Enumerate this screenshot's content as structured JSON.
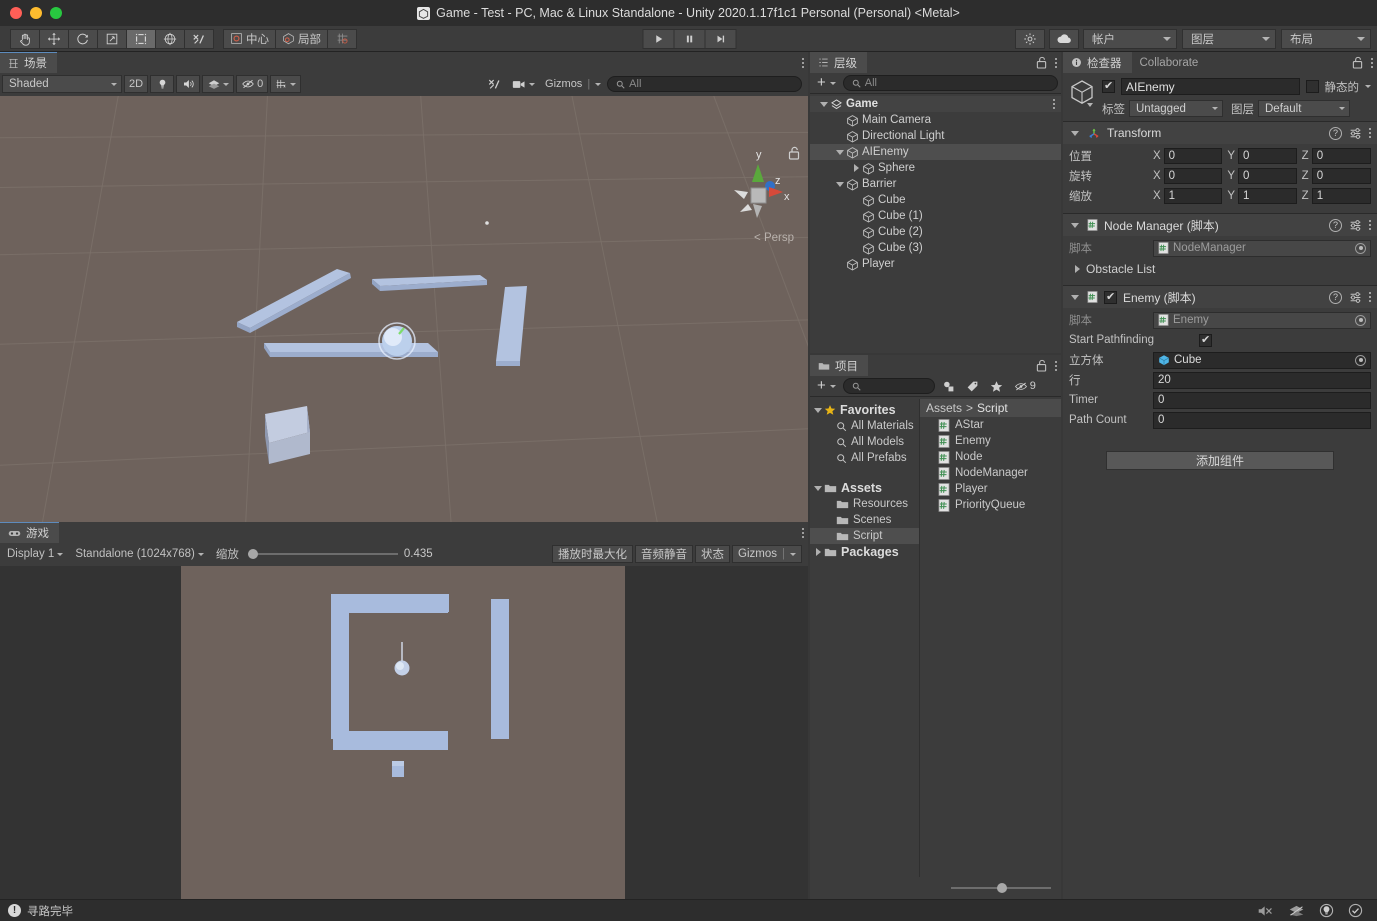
{
  "titlebar": {
    "title": "Game - Test - PC, Mac & Linux Standalone - Unity 2020.1.17f1c1 Personal (Personal) <Metal>",
    "logo_icon": "unity-logo-icon"
  },
  "toolbar": {
    "tools": [
      {
        "name": "hand-tool",
        "icon": "hand-icon"
      },
      {
        "name": "move-tool",
        "icon": "move-arrows-icon"
      },
      {
        "name": "rotate-tool",
        "icon": "rotate-icon"
      },
      {
        "name": "scale-tool",
        "icon": "scale-icon"
      },
      {
        "name": "rect-tool",
        "icon": "rect-transform-icon",
        "active": true
      },
      {
        "name": "transform-tool",
        "icon": "transform-globe-icon"
      },
      {
        "name": "custom-editor-tool",
        "icon": "wrench-hammer-icon"
      }
    ],
    "pivot_label": "中心",
    "pivot_icon": "pivot-center-icon",
    "space_label": "局部",
    "space_icon": "local-space-icon",
    "grid_snap_icon": "grid-snap-icon",
    "play_label": "▶",
    "pause_label": "❚❚",
    "step_label": "▶❘",
    "cloud_icon": "cloud-icon",
    "services_icon": "services-settings-icon",
    "account_label": "帐户",
    "layers_label": "图层",
    "layout_label": "布局"
  },
  "scene": {
    "tab_label": "场景",
    "tab_icon": "scene-grid-icon",
    "draw_mode": "Shaded",
    "toggle_2d": "2D",
    "lighting_icon": "lightbulb-icon",
    "audio_icon": "audio-icon",
    "fx_icon": "effects-icon",
    "hidden_count": "0",
    "hidden_icon": "eye-off-icon",
    "grid_icon": "grid-visibility-icon",
    "tools_icon": "scene-tools-icon",
    "camera_icon": "scene-camera-icon",
    "gizmos_label": "Gizmos",
    "search_placeholder": "All",
    "search_icon": "search-icon",
    "axis_labels": {
      "x": "x",
      "y": "y",
      "z": "z"
    },
    "perspective_label": "Persp",
    "lock_icon": "lock-open-icon"
  },
  "game": {
    "tab_label": "游戏",
    "tab_icon": "gamepad-icon",
    "display_label": "Display 1",
    "resolution_label": "Standalone (1024x768)",
    "scale_label": "缩放",
    "scale_value": "0.435",
    "maximize_label": "播放时最大化",
    "mute_label": "音频静音",
    "stats_label": "状态",
    "gizmos_label": "Gizmos"
  },
  "hierarchy": {
    "tab_label": "层级",
    "tab_icon": "hierarchy-icon",
    "lock_icon": "lock-open-icon",
    "add_label": "+",
    "search_placeholder": "All",
    "search_icon": "search-icon",
    "items": [
      {
        "label": "Game",
        "depth": 0,
        "icon": "scene-icon",
        "arrow": "down",
        "root": true,
        "menu": true
      },
      {
        "label": "Main Camera",
        "depth": 1,
        "icon": "gameobject-icon",
        "arrow": "none"
      },
      {
        "label": "Directional Light",
        "depth": 1,
        "icon": "gameobject-icon",
        "arrow": "none"
      },
      {
        "label": "AIEnemy",
        "depth": 1,
        "icon": "gameobject-icon",
        "arrow": "down",
        "selected": true
      },
      {
        "label": "Sphere",
        "depth": 2,
        "icon": "gameobject-icon",
        "arrow": "right"
      },
      {
        "label": "Barrier",
        "depth": 1,
        "icon": "gameobject-icon",
        "arrow": "down"
      },
      {
        "label": "Cube",
        "depth": 2,
        "icon": "gameobject-icon",
        "arrow": "none"
      },
      {
        "label": "Cube (1)",
        "depth": 2,
        "icon": "gameobject-icon",
        "arrow": "none"
      },
      {
        "label": "Cube (2)",
        "depth": 2,
        "icon": "gameobject-icon",
        "arrow": "none"
      },
      {
        "label": "Cube (3)",
        "depth": 2,
        "icon": "gameobject-icon",
        "arrow": "none"
      },
      {
        "label": "Player",
        "depth": 1,
        "icon": "gameobject-icon",
        "arrow": "none"
      }
    ]
  },
  "project": {
    "tab_label": "项目",
    "tab_icon": "folder-icon",
    "lock_icon": "lock-open-icon",
    "add_label": "+",
    "search_placeholder": "",
    "search_icon": "search-icon",
    "filter_type_icon": "filter-by-type-icon",
    "filter_label_icon": "filter-by-label-icon",
    "favorites_filter_icon": "star-icon",
    "hidden_packages_icon": "eye-off-icon",
    "hidden_packages_count": "9",
    "tree": [
      {
        "label": "Favorites",
        "depth": 0,
        "arrow": "down",
        "icon": "star-icon"
      },
      {
        "label": "All Materials",
        "depth": 1,
        "arrow": "none",
        "icon": "search-icon"
      },
      {
        "label": "All Models",
        "depth": 1,
        "arrow": "none",
        "icon": "search-icon"
      },
      {
        "label": "All Prefabs",
        "depth": 1,
        "arrow": "none",
        "icon": "search-icon"
      },
      {
        "label": "",
        "depth": 0,
        "arrow": "none",
        "icon": "spacer"
      },
      {
        "label": "Assets",
        "depth": 0,
        "arrow": "down",
        "icon": "folder-open-icon"
      },
      {
        "label": "Resources",
        "depth": 1,
        "arrow": "none",
        "icon": "folder-icon"
      },
      {
        "label": "Scenes",
        "depth": 1,
        "arrow": "none",
        "icon": "folder-icon"
      },
      {
        "label": "Script",
        "depth": 1,
        "arrow": "none",
        "icon": "folder-icon",
        "selected": true
      },
      {
        "label": "Packages",
        "depth": 0,
        "arrow": "right",
        "icon": "folder-icon"
      }
    ],
    "breadcrumb": [
      "Assets",
      "Script"
    ],
    "files": [
      {
        "label": "AStar",
        "icon": "csharp-script-icon"
      },
      {
        "label": "Enemy",
        "icon": "csharp-script-icon"
      },
      {
        "label": "Node",
        "icon": "csharp-script-icon"
      },
      {
        "label": "NodeManager",
        "icon": "csharp-script-icon"
      },
      {
        "label": "Player",
        "icon": "csharp-script-icon"
      },
      {
        "label": "PriorityQueue",
        "icon": "csharp-script-icon"
      }
    ]
  },
  "inspector": {
    "tab_label": "检查器",
    "tab_icon": "info-icon",
    "collab_tab_label": "Collaborate",
    "lock_icon": "lock-open-icon",
    "object": {
      "icon": "gameobject-icon",
      "enabled": true,
      "name": "AIEnemy",
      "static_label": "静态的",
      "static_checked": false,
      "tag_label": "标签",
      "tag_value": "Untagged",
      "layer_label": "图层",
      "layer_value": "Default"
    },
    "components": [
      {
        "title": "Transform",
        "icon": "transform-icon",
        "expanded": true,
        "has_checkbox": false,
        "rows": [
          {
            "label": "位置",
            "type": "vector3",
            "x": "0",
            "y": "0",
            "z": "0"
          },
          {
            "label": "旋转",
            "type": "vector3",
            "x": "0",
            "y": "0",
            "z": "0"
          },
          {
            "label": "缩放",
            "type": "vector3",
            "x": "1",
            "y": "1",
            "z": "1"
          }
        ]
      },
      {
        "title": "Node Manager  (脚本)",
        "icon": "csharp-script-icon",
        "expanded": true,
        "has_checkbox": false,
        "rows": [
          {
            "label": "脚本",
            "type": "object",
            "value": "NodeManager",
            "value_icon": "csharp-script-icon",
            "disabled": true
          },
          {
            "label": "Obstacle List",
            "type": "foldout",
            "expanded": false
          }
        ]
      },
      {
        "title": "Enemy  (脚本)",
        "icon": "csharp-script-icon",
        "expanded": true,
        "has_checkbox": true,
        "checked": true,
        "rows": [
          {
            "label": "脚本",
            "type": "object",
            "value": "Enemy",
            "value_icon": "csharp-script-icon",
            "disabled": true
          },
          {
            "label": "Start Pathfinding",
            "type": "checkbox",
            "checked": true
          },
          {
            "label": "立方体",
            "type": "object",
            "value": "Cube",
            "value_icon": "prefab-cube-icon"
          },
          {
            "label": "行",
            "type": "text",
            "value": "20"
          },
          {
            "label": "Timer",
            "type": "text",
            "value": "0"
          },
          {
            "label": "Path Count",
            "type": "text",
            "value": "0"
          }
        ]
      }
    ],
    "add_component_label": "添加组件"
  },
  "statusbar": {
    "message": "寻路完毕",
    "message_icon": "warning-icon",
    "right_icons": [
      {
        "name": "mute-audio-icon"
      },
      {
        "name": "layers-status-icon"
      },
      {
        "name": "global-illumination-icon"
      },
      {
        "name": "ready-check-icon"
      }
    ]
  },
  "colors": {
    "scene_bg": "#6e625c",
    "wall": "#a8bbdd",
    "panel_bg": "#3c3c3c",
    "selection": "#4e4e4e",
    "accent_tab": "#5d8bbd",
    "axis_x": "#d64a3a",
    "axis_y": "#5aa83c",
    "axis_z": "#3070c8"
  }
}
